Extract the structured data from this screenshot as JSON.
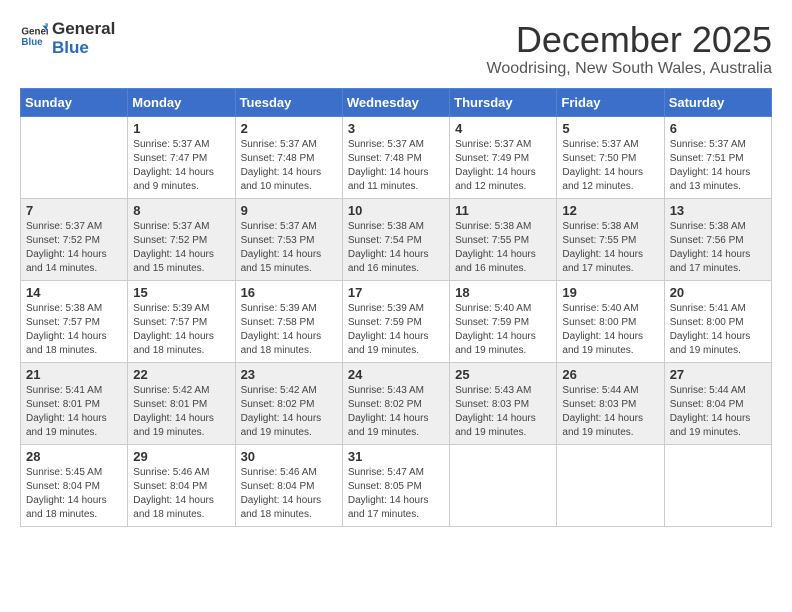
{
  "logo": {
    "general": "General",
    "blue": "Blue"
  },
  "header": {
    "title": "December 2025",
    "subtitle": "Woodrising, New South Wales, Australia"
  },
  "weekdays": [
    "Sunday",
    "Monday",
    "Tuesday",
    "Wednesday",
    "Thursday",
    "Friday",
    "Saturday"
  ],
  "weeks": [
    [
      {
        "day": "",
        "info": ""
      },
      {
        "day": "1",
        "info": "Sunrise: 5:37 AM\nSunset: 7:47 PM\nDaylight: 14 hours\nand 9 minutes."
      },
      {
        "day": "2",
        "info": "Sunrise: 5:37 AM\nSunset: 7:48 PM\nDaylight: 14 hours\nand 10 minutes."
      },
      {
        "day": "3",
        "info": "Sunrise: 5:37 AM\nSunset: 7:48 PM\nDaylight: 14 hours\nand 11 minutes."
      },
      {
        "day": "4",
        "info": "Sunrise: 5:37 AM\nSunset: 7:49 PM\nDaylight: 14 hours\nand 12 minutes."
      },
      {
        "day": "5",
        "info": "Sunrise: 5:37 AM\nSunset: 7:50 PM\nDaylight: 14 hours\nand 12 minutes."
      },
      {
        "day": "6",
        "info": "Sunrise: 5:37 AM\nSunset: 7:51 PM\nDaylight: 14 hours\nand 13 minutes."
      }
    ],
    [
      {
        "day": "7",
        "info": "Sunrise: 5:37 AM\nSunset: 7:52 PM\nDaylight: 14 hours\nand 14 minutes."
      },
      {
        "day": "8",
        "info": "Sunrise: 5:37 AM\nSunset: 7:52 PM\nDaylight: 14 hours\nand 15 minutes."
      },
      {
        "day": "9",
        "info": "Sunrise: 5:37 AM\nSunset: 7:53 PM\nDaylight: 14 hours\nand 15 minutes."
      },
      {
        "day": "10",
        "info": "Sunrise: 5:38 AM\nSunset: 7:54 PM\nDaylight: 14 hours\nand 16 minutes."
      },
      {
        "day": "11",
        "info": "Sunrise: 5:38 AM\nSunset: 7:55 PM\nDaylight: 14 hours\nand 16 minutes."
      },
      {
        "day": "12",
        "info": "Sunrise: 5:38 AM\nSunset: 7:55 PM\nDaylight: 14 hours\nand 17 minutes."
      },
      {
        "day": "13",
        "info": "Sunrise: 5:38 AM\nSunset: 7:56 PM\nDaylight: 14 hours\nand 17 minutes."
      }
    ],
    [
      {
        "day": "14",
        "info": "Sunrise: 5:38 AM\nSunset: 7:57 PM\nDaylight: 14 hours\nand 18 minutes."
      },
      {
        "day": "15",
        "info": "Sunrise: 5:39 AM\nSunset: 7:57 PM\nDaylight: 14 hours\nand 18 minutes."
      },
      {
        "day": "16",
        "info": "Sunrise: 5:39 AM\nSunset: 7:58 PM\nDaylight: 14 hours\nand 18 minutes."
      },
      {
        "day": "17",
        "info": "Sunrise: 5:39 AM\nSunset: 7:59 PM\nDaylight: 14 hours\nand 19 minutes."
      },
      {
        "day": "18",
        "info": "Sunrise: 5:40 AM\nSunset: 7:59 PM\nDaylight: 14 hours\nand 19 minutes."
      },
      {
        "day": "19",
        "info": "Sunrise: 5:40 AM\nSunset: 8:00 PM\nDaylight: 14 hours\nand 19 minutes."
      },
      {
        "day": "20",
        "info": "Sunrise: 5:41 AM\nSunset: 8:00 PM\nDaylight: 14 hours\nand 19 minutes."
      }
    ],
    [
      {
        "day": "21",
        "info": "Sunrise: 5:41 AM\nSunset: 8:01 PM\nDaylight: 14 hours\nand 19 minutes."
      },
      {
        "day": "22",
        "info": "Sunrise: 5:42 AM\nSunset: 8:01 PM\nDaylight: 14 hours\nand 19 minutes."
      },
      {
        "day": "23",
        "info": "Sunrise: 5:42 AM\nSunset: 8:02 PM\nDaylight: 14 hours\nand 19 minutes."
      },
      {
        "day": "24",
        "info": "Sunrise: 5:43 AM\nSunset: 8:02 PM\nDaylight: 14 hours\nand 19 minutes."
      },
      {
        "day": "25",
        "info": "Sunrise: 5:43 AM\nSunset: 8:03 PM\nDaylight: 14 hours\nand 19 minutes."
      },
      {
        "day": "26",
        "info": "Sunrise: 5:44 AM\nSunset: 8:03 PM\nDaylight: 14 hours\nand 19 minutes."
      },
      {
        "day": "27",
        "info": "Sunrise: 5:44 AM\nSunset: 8:04 PM\nDaylight: 14 hours\nand 19 minutes."
      }
    ],
    [
      {
        "day": "28",
        "info": "Sunrise: 5:45 AM\nSunset: 8:04 PM\nDaylight: 14 hours\nand 18 minutes."
      },
      {
        "day": "29",
        "info": "Sunrise: 5:46 AM\nSunset: 8:04 PM\nDaylight: 14 hours\nand 18 minutes."
      },
      {
        "day": "30",
        "info": "Sunrise: 5:46 AM\nSunset: 8:04 PM\nDaylight: 14 hours\nand 18 minutes."
      },
      {
        "day": "31",
        "info": "Sunrise: 5:47 AM\nSunset: 8:05 PM\nDaylight: 14 hours\nand 17 minutes."
      },
      {
        "day": "",
        "info": ""
      },
      {
        "day": "",
        "info": ""
      },
      {
        "day": "",
        "info": ""
      }
    ]
  ]
}
